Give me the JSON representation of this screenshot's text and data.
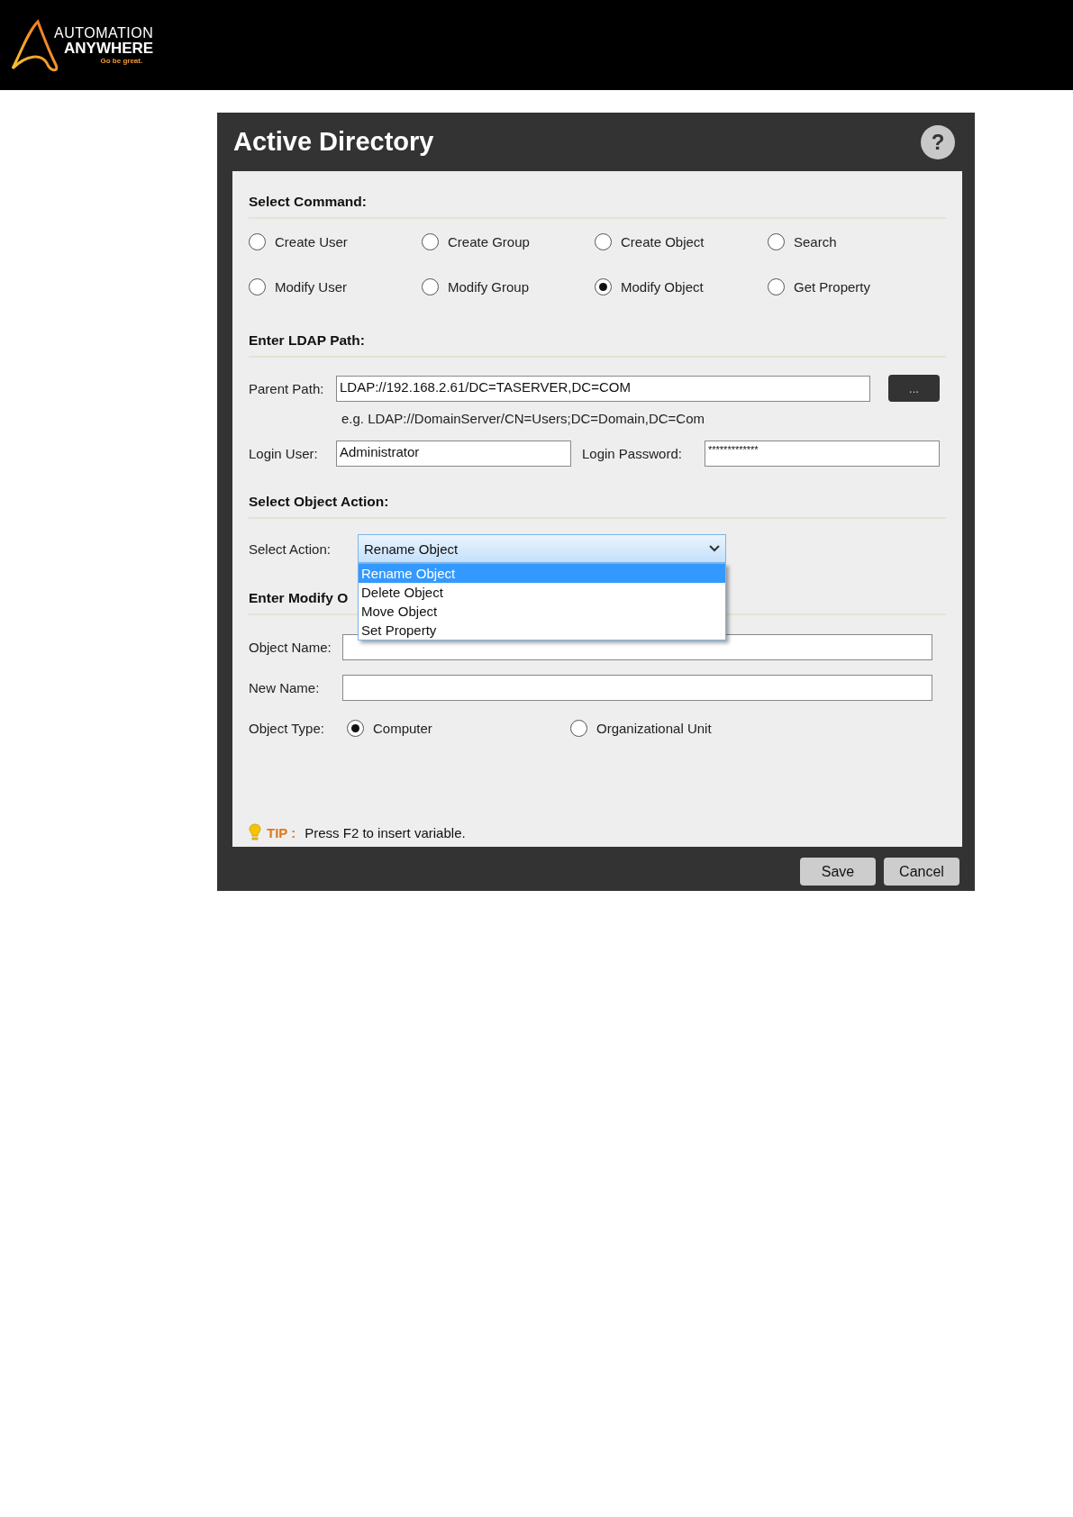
{
  "header": {
    "logo": {
      "line_1": "AUTOMATION",
      "line_2": "ANYWHERE",
      "tagline": "Go be great."
    }
  },
  "dialog": {
    "title": "Active Directory",
    "help": "?",
    "command_section": {
      "heading": "Select Command:",
      "options": [
        {
          "label": "Create User",
          "selected": false
        },
        {
          "label": "Create Group",
          "selected": false
        },
        {
          "label": "Create Object",
          "selected": false
        },
        {
          "label": "Search",
          "selected": false
        },
        {
          "label": "Modify User",
          "selected": false
        },
        {
          "label": "Modify Group",
          "selected": false
        },
        {
          "label": "Modify Object",
          "selected": true
        },
        {
          "label": "Get Property",
          "selected": false
        }
      ]
    },
    "ldap_section": {
      "heading": "Enter LDAP Path:",
      "parent_path": {
        "label": "Parent Path:",
        "value": "LDAP://192.168.2.61/DC=TASERVER,DC=COM"
      },
      "browse_button": "...",
      "example": "e.g. LDAP://DomainServer/CN=Users;DC=Domain,DC=Com",
      "login_user": {
        "label": "Login User:",
        "value": "Administrator"
      },
      "login_password": {
        "label": "Login Password:",
        "value": "*************"
      }
    },
    "action_section": {
      "heading": "Select Object Action:",
      "select_action": {
        "label": "Select Action:",
        "value": "Rename Object",
        "expanded": true,
        "options": [
          {
            "label": "Rename Object",
            "selected": true
          },
          {
            "label": "Delete Object",
            "selected": false
          },
          {
            "label": "Move Object",
            "selected": false
          },
          {
            "label": "Set Property",
            "selected": false
          }
        ]
      }
    },
    "modify_section": {
      "heading": "Enter Modify O",
      "object_name": {
        "label": "Object Name:"
      },
      "new_name": {
        "label": "New Name:"
      },
      "object_type": {
        "label": "Object Type:",
        "options": [
          {
            "label": "Computer",
            "selected": true
          },
          {
            "label": "Organizational Unit",
            "selected": false
          }
        ]
      }
    },
    "tip": {
      "label": "TIP :",
      "text": "Press F2 to insert variable."
    },
    "buttons": [
      "Save",
      "Cancel"
    ]
  }
}
